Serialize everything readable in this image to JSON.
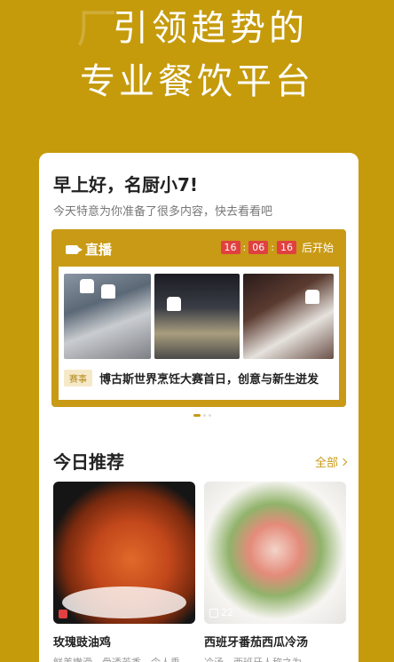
{
  "hero": {
    "line1": "引领趋势的",
    "line2": "专业餐饮平台",
    "deco_glyph": "厂"
  },
  "greeting": {
    "title": "早上好，名厨小7!",
    "subtitle": "今天特意为你准备了很多内容，快去看看吧"
  },
  "live": {
    "label": "直播",
    "countdown": {
      "h": "16",
      "m": "06",
      "s": "16",
      "suffix": "后开始"
    },
    "news_tag": "赛事",
    "news_title": "博古斯世界烹饪大赛首日，创意与新生迸发"
  },
  "recommend": {
    "title": "今日推荐",
    "all_label": "全部",
    "items": [
      {
        "name": "玫瑰豉油鸡",
        "desc": "鲜美嫩滑，骨透芳香，令人垂",
        "likes": ""
      },
      {
        "name": "西班牙番茄西瓜冷汤",
        "desc": "冷汤，西班牙人称之为",
        "likes": "22"
      }
    ]
  },
  "colors": {
    "brand": "#C59B0C",
    "accent": "#C89A16",
    "countdown": "#E04040"
  }
}
